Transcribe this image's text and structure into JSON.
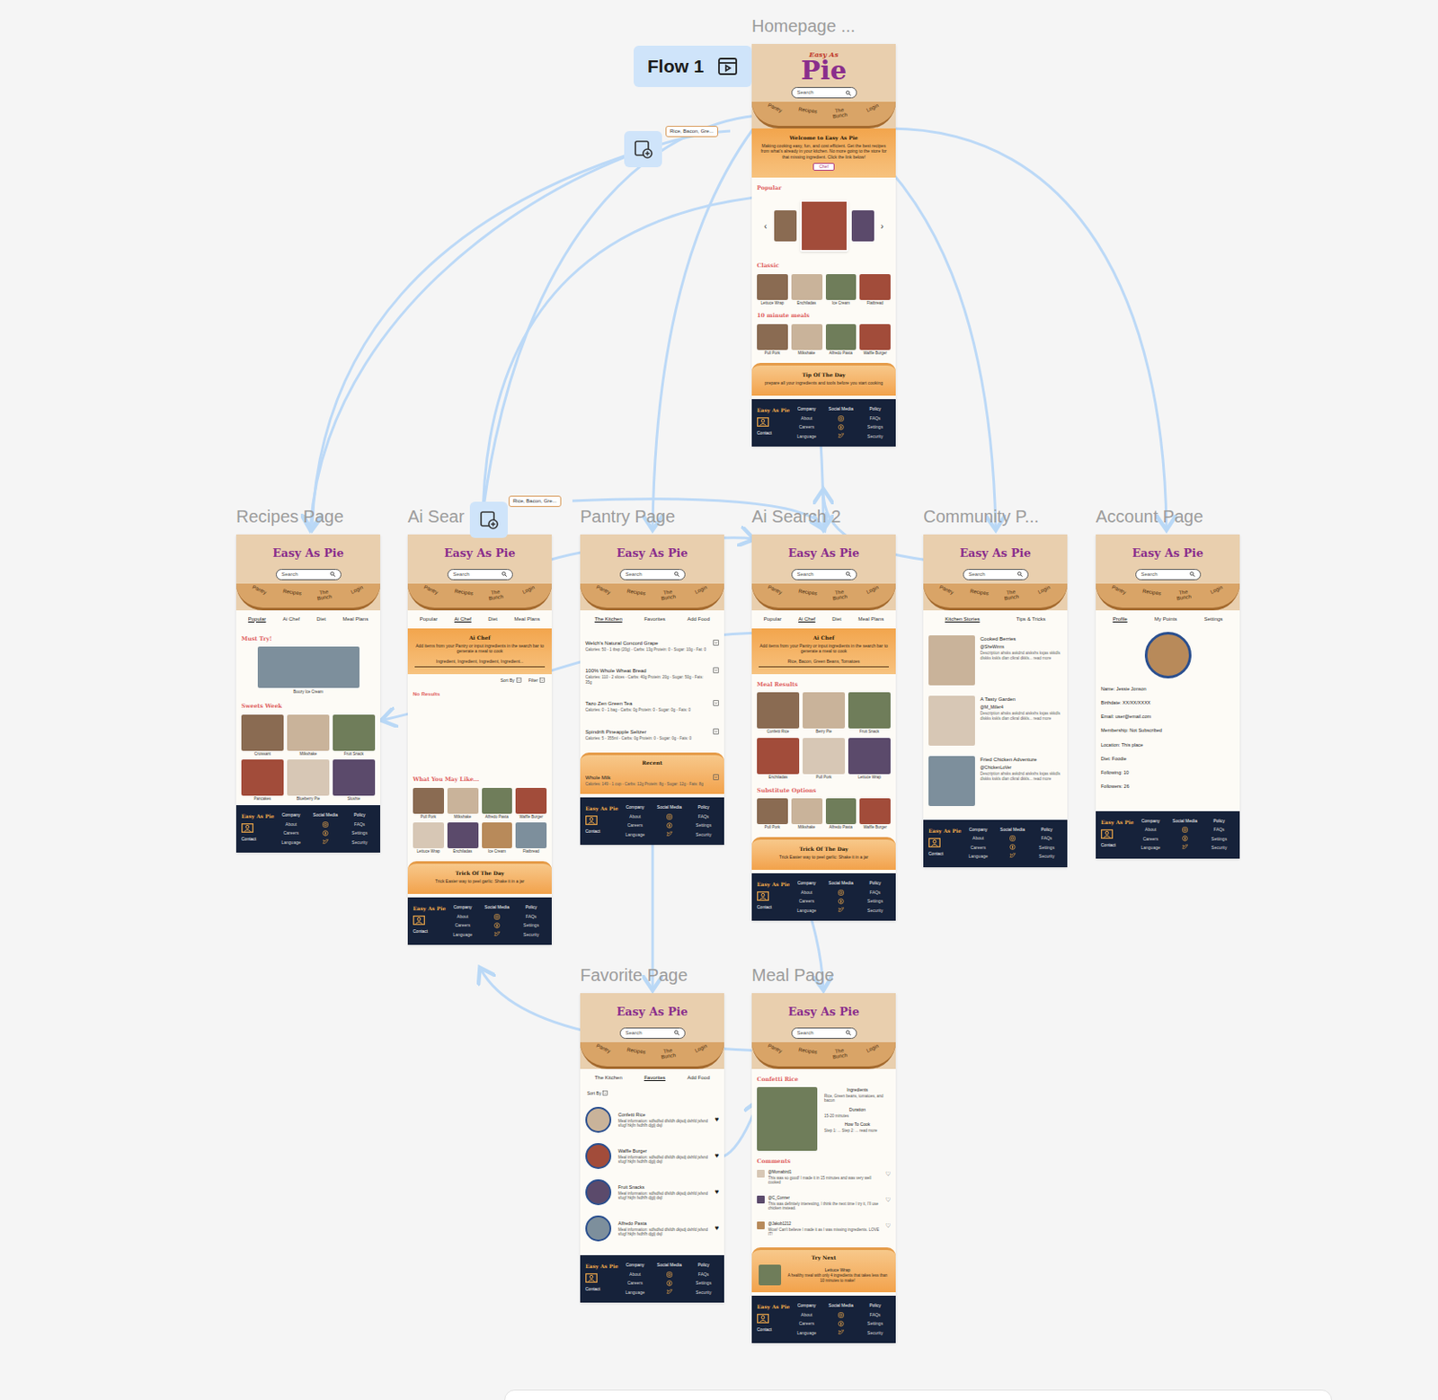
{
  "flow": {
    "label": "Flow 1"
  },
  "overlays": [
    {
      "text": "Rice, Bacon, Gre..."
    },
    {
      "text": "Rice, Bacon, Gre..."
    }
  ],
  "header": {
    "logo": "Easy As Pie",
    "search": "Search",
    "nav": [
      "Pantry",
      "Recipes",
      "The Bunch",
      "Login"
    ]
  },
  "footer": {
    "brand": "Easy As Pie",
    "contact": "Contact",
    "columns": [
      {
        "title": "Company",
        "links": [
          "About",
          "Careers",
          "Language"
        ]
      },
      {
        "title": "Social Media",
        "links": []
      },
      {
        "title": "Policy",
        "links": [
          "FAQs",
          "Settings",
          "Security"
        ]
      }
    ]
  },
  "frames": [
    {
      "title": "Homepage ...",
      "logo": {
        "top": "Easy As",
        "main": "Pie"
      },
      "tabs": [],
      "sections": [
        {
          "kind": "banner",
          "title": "Welcome to Easy As Pie",
          "text": "Making cooking easy, fun, and cost efficient. Get the best recipes from what's already in your kitchen. No more going to the store for that missing ingredient. Click the link below!",
          "button": "Chef"
        },
        {
          "kind": "heading",
          "text": "Popular"
        },
        {
          "kind": "carousel",
          "prev": "‹",
          "next": "›"
        },
        {
          "kind": "heading",
          "text": "Classic"
        },
        {
          "kind": "grid",
          "items": [
            "Lettuce Wrap",
            "Enchiladas",
            "Ice Cream",
            "Flatbread"
          ]
        },
        {
          "kind": "heading",
          "text": "10 minute meals"
        },
        {
          "kind": "grid",
          "items": [
            "Pull Pork",
            "Milkshake",
            "Alfredo Pasta",
            "Waffle Burger"
          ]
        },
        {
          "kind": "tip",
          "title": "Tip Of The Day",
          "text": "prepare all your ingredients and tools before you start cooking"
        }
      ]
    },
    {
      "title": "Recipes Page",
      "tabs": [
        {
          "label": "Popular",
          "selected": true
        },
        {
          "label": "Ai Chef",
          "selected": false
        },
        {
          "label": "Diet",
          "selected": false
        },
        {
          "label": "Meal Plans",
          "selected": false
        }
      ],
      "sections": [
        {
          "kind": "heading",
          "text": "Must Try!"
        },
        {
          "kind": "feature",
          "caption": "Boozy Ice Cream"
        },
        {
          "kind": "heading",
          "text": "Sweets Week"
        },
        {
          "kind": "grid",
          "items": [
            "Croissant",
            "Milkshake",
            "Fruit Snack",
            "Pancakes",
            "Blueberry Pie",
            "Slushie"
          ]
        }
      ]
    },
    {
      "title": "Ai Sear",
      "tabs": [
        {
          "label": "Popular",
          "selected": false
        },
        {
          "label": "Ai Chef",
          "selected": true
        },
        {
          "label": "Diet",
          "selected": false
        },
        {
          "label": "Meal Plans",
          "selected": false
        }
      ],
      "sections": [
        {
          "kind": "banner",
          "title": "Ai Chef",
          "text": "Add items from your Pantry or input ingredients in the search bar to generate a meal to cook",
          "input": "Ingredient, Ingredient, Ingredient, Ingredient..."
        },
        {
          "kind": "sortbar",
          "labels": [
            "Sort By",
            "Filter"
          ]
        },
        {
          "kind": "empty",
          "text": "No Results"
        },
        {
          "kind": "heading",
          "text": "What You May Like..."
        },
        {
          "kind": "grid",
          "items": [
            "Pull Pork",
            "Milkshake",
            "Alfredo Pasta",
            "Waffle Burger",
            "Lettuce Wrap",
            "Enchiladas",
            "Ice Cream",
            "Flatbread"
          ]
        },
        {
          "kind": "tip",
          "title": "Trick Of The Day",
          "text": "Trick Easier way to peel garlic: Shake it in a jar"
        }
      ]
    },
    {
      "title": "Pantry Page",
      "tabs": [
        {
          "label": "The Kitchen",
          "selected": true
        },
        {
          "label": "Favorites",
          "selected": false
        },
        {
          "label": "Add Food",
          "selected": false
        }
      ],
      "sections": [
        {
          "kind": "pantry",
          "items": [
            {
              "name": "Welch's Natural Concord Grape",
              "info": "Calories: 50 - 1 tbsp (20g) - Carbs: 13g Protein: 0 - Sugar: 10g - Fat: 0"
            },
            {
              "name": "100% Whole Wheat Bread",
              "info": "Calories: 110 - 2 slices - Carbs: 40g Protein: 20g - Sugar: 50g - Fats: 35g"
            },
            {
              "name": "Tazo Zen Green Tea",
              "info": "Calories: 0 - 1 bag - Carbs: 0g Protein: 0 - Sugar: 0g - Fats: 0"
            },
            {
              "name": "Spindrift Pineapple Seltzer",
              "info": "Calories: 5 - 355ml - Carbs: 0g Protein: 0 - Sugar: 0g - Fats: 0"
            }
          ]
        },
        {
          "kind": "recent",
          "title": "Recent",
          "items": [
            {
              "name": "Whole Milk",
              "info": "Calories: 149 - 1 cup - Carbs: 12g Protein: 8g - Sugar: 12g - Fats: 8g"
            }
          ]
        }
      ]
    },
    {
      "title": "Ai Search 2",
      "tabs": [
        {
          "label": "Popular",
          "selected": false
        },
        {
          "label": "Ai Chef",
          "selected": true
        },
        {
          "label": "Diet",
          "selected": false
        },
        {
          "label": "Meal Plans",
          "selected": false
        }
      ],
      "sections": [
        {
          "kind": "banner",
          "title": "Ai Chef",
          "text": "Add items from your Pantry or input ingredients in the search bar to generate a meal to cook",
          "input": "Rice, Bacon, Green Beans, Tomatoes"
        },
        {
          "kind": "heading",
          "text": "Meal Results"
        },
        {
          "kind": "grid",
          "items": [
            "Confetti Rice",
            "Berry Pie",
            "Fruit Snack",
            "Enchiladas",
            "Pull Pork",
            "Lettuce Wrap"
          ]
        },
        {
          "kind": "heading",
          "text": "Substitute Options"
        },
        {
          "kind": "grid",
          "items": [
            "Pull Pork",
            "Milkshake",
            "Alfredo Pasta",
            "Waffle Burger"
          ]
        },
        {
          "kind": "tip",
          "title": "Trick Of The Day",
          "text": "Trick Easier way to peel garlic: Shake it in a jar"
        }
      ]
    },
    {
      "title": "Community P...",
      "tabs": [
        {
          "label": "Kitchen Stories",
          "selected": true
        },
        {
          "label": "Tips & Tricks",
          "selected": false
        }
      ],
      "sections": [
        {
          "kind": "posts",
          "items": [
            {
              "title": "Cooked Berries",
              "user": "@SheWinns",
              "text": "Description ahsks askdnd aiskshs ksjas skkdls dlskks kskls dlan clkral dkkls... read more"
            },
            {
              "title": "A Tasty Garden",
              "user": "@M_Miller4",
              "text": "Description ahsks askdnd aiskshs ksjas skkdls dlskks kskls dlan clkral dkkls... read more"
            },
            {
              "title": "Fried Chicken Adventure",
              "user": "@ChickenLoVer",
              "text": "Description ahsks askdnd aiskshs ksjas skkdls dlskks kskls dlan clkral dkkls... read more"
            }
          ]
        }
      ]
    },
    {
      "title": "Account Page",
      "tabs": [
        {
          "label": "Profile",
          "selected": true
        },
        {
          "label": "My Points",
          "selected": false
        },
        {
          "label": "Settings",
          "selected": false
        }
      ],
      "sections": [
        {
          "kind": "profile",
          "fields": [
            "Name: Jessie Jonson",
            "Birthdate: XX/XX/XXXX",
            "Email: user@email.com",
            "Membership: Not Subscribed",
            "Location: This place",
            "Diet: Foodie",
            "Following: 10",
            "Followers: 26"
          ]
        }
      ]
    },
    {
      "title": "Favorite Page",
      "tabs": [
        {
          "label": "The Kitchen",
          "selected": false
        },
        {
          "label": "Favorites",
          "selected": true
        },
        {
          "label": "Add Food",
          "selected": false
        }
      ],
      "sections": [
        {
          "kind": "sortbar",
          "labels": [
            "Sort By"
          ]
        },
        {
          "kind": "favorites",
          "items": [
            {
              "name": "Confetti Rice",
              "text": "Meal information: sdfsdfsd dfsfdh dkjsdj dshfd jsfsnd sfugf hkjfn fsdhfh djglj dsjl",
              "icon": "♥"
            },
            {
              "name": "Waffle Burger",
              "text": "Meal information: sdfsdfsd dfsfdh dkjsdj dshfd jsfsnd sfugf hkjfn fsdhfh djglj dsjl",
              "icon": "♥"
            },
            {
              "name": "Fruit Snacks",
              "text": "Meal information: sdfsdfsd dfsfdh dkjsdj dshfd jsfsnd sfugf hkjfn fsdhfh djglj dsjl",
              "icon": "♥"
            },
            {
              "name": "Alfredo Pasta",
              "text": "Meal information: sdfsdfsd dfsfdh dkjsdj dshfd jsfsnd sfugf hkjfn fsdhfh djglj dsjl",
              "icon": "♥"
            }
          ]
        }
      ]
    },
    {
      "title": "Meal Page",
      "tabs": [],
      "sections": [
        {
          "kind": "heading",
          "text": "Confetti Rice"
        },
        {
          "kind": "meal",
          "details": [
            {
              "label": "Ingredients",
              "text": "Rice, Green beans, tomatoes, and bacon"
            },
            {
              "label": "Duration",
              "text": "15-20 minutes"
            },
            {
              "label": "How To Cook",
              "text": "Step 1: ... Step 2: ... read more"
            }
          ]
        },
        {
          "kind": "heading",
          "text": "Comments"
        },
        {
          "kind": "comments",
          "items": [
            {
              "user": "@Momabird1",
              "text": "This was so good! I made it in 15 minutes and was very well cooked",
              "icon": "♡"
            },
            {
              "user": "@C_Conner",
              "text": "This was definitely interesting, I think the next time I try it, I'll use chicken instead.",
              "icon": "♡"
            },
            {
              "user": "@Jakob1212",
              "text": "Wow! Can't believe I made it as I was missing ingredients. LOVE IT!",
              "icon": "♡"
            }
          ]
        },
        {
          "kind": "trynext",
          "title": "Try Next",
          "caption": "Lettuce Wrap",
          "text": "A healthy meal with only 4 ingredients that takes less than 10 minutes to make!"
        }
      ]
    }
  ]
}
